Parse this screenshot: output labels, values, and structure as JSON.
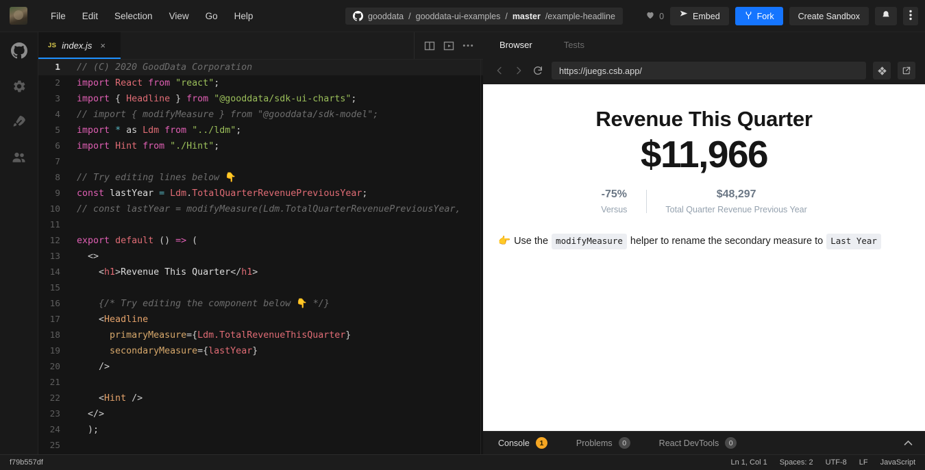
{
  "topbar": {
    "menu": [
      "File",
      "Edit",
      "Selection",
      "View",
      "Go",
      "Help"
    ],
    "repo": {
      "owner": "gooddata",
      "sep1": "/",
      "name": "gooddata-ui-examples",
      "sep2": "/",
      "branch": "master",
      "path": "/example-headline",
      "icon": "github-icon"
    },
    "likes_count": "0",
    "like_icon": "heart-icon",
    "embed_label": "Embed",
    "embed_icon": "share-icon",
    "fork_label": "Fork",
    "fork_icon": "fork-icon",
    "create_sandbox_label": "Create Sandbox",
    "notification_icon": "bell-icon",
    "more_icon": "kebab-menu-icon",
    "accent_color": "#1575ff"
  },
  "activitybar": {
    "items": [
      {
        "icon": "github-icon",
        "name": "github"
      },
      {
        "icon": "gear-icon",
        "name": "settings"
      },
      {
        "icon": "rocket-icon",
        "name": "deploy"
      },
      {
        "icon": "people-icon",
        "name": "collaborators"
      }
    ]
  },
  "editor": {
    "tab": {
      "badge": "JS",
      "name": "index.js",
      "close": "×"
    },
    "actions": [
      {
        "icon": "split-editor-icon"
      },
      {
        "icon": "preview-panel-icon"
      },
      {
        "icon": "more-options-icon"
      }
    ],
    "active_line": 1,
    "lines": [
      {
        "n": 1,
        "tokens": [
          {
            "t": "comment",
            "s": "// (C) 2020 GoodData Corporation"
          }
        ]
      },
      {
        "n": 2,
        "tokens": [
          {
            "t": "kw",
            "s": "import"
          },
          {
            "t": "plain",
            "s": " "
          },
          {
            "t": "id",
            "s": "React"
          },
          {
            "t": "plain",
            "s": " "
          },
          {
            "t": "kw",
            "s": "from"
          },
          {
            "t": "plain",
            "s": " "
          },
          {
            "t": "str",
            "s": "\"react\""
          },
          {
            "t": "punct",
            "s": ";"
          }
        ]
      },
      {
        "n": 3,
        "tokens": [
          {
            "t": "kw",
            "s": "import"
          },
          {
            "t": "plain",
            "s": " { "
          },
          {
            "t": "id",
            "s": "Headline"
          },
          {
            "t": "plain",
            "s": " } "
          },
          {
            "t": "kw",
            "s": "from"
          },
          {
            "t": "plain",
            "s": " "
          },
          {
            "t": "str",
            "s": "\"@gooddata/sdk-ui-charts\""
          },
          {
            "t": "punct",
            "s": ";"
          }
        ]
      },
      {
        "n": 4,
        "tokens": [
          {
            "t": "comment",
            "s": "// import { modifyMeasure } from \"@gooddata/sdk-model\";"
          }
        ]
      },
      {
        "n": 5,
        "tokens": [
          {
            "t": "kw",
            "s": "import"
          },
          {
            "t": "plain",
            "s": " "
          },
          {
            "t": "op",
            "s": "*"
          },
          {
            "t": "plain",
            "s": " as "
          },
          {
            "t": "id",
            "s": "Ldm"
          },
          {
            "t": "plain",
            "s": " "
          },
          {
            "t": "kw",
            "s": "from"
          },
          {
            "t": "plain",
            "s": " "
          },
          {
            "t": "str",
            "s": "\"../ldm\""
          },
          {
            "t": "punct",
            "s": ";"
          }
        ]
      },
      {
        "n": 6,
        "tokens": [
          {
            "t": "kw",
            "s": "import"
          },
          {
            "t": "plain",
            "s": " "
          },
          {
            "t": "id",
            "s": "Hint"
          },
          {
            "t": "plain",
            "s": " "
          },
          {
            "t": "kw",
            "s": "from"
          },
          {
            "t": "plain",
            "s": " "
          },
          {
            "t": "str",
            "s": "\"./Hint\""
          },
          {
            "t": "punct",
            "s": ";"
          }
        ]
      },
      {
        "n": 7,
        "tokens": []
      },
      {
        "n": 8,
        "tokens": [
          {
            "t": "comment",
            "s": "// Try editing lines below "
          },
          {
            "t": "plain",
            "s": "👇"
          }
        ]
      },
      {
        "n": 9,
        "tokens": [
          {
            "t": "kw",
            "s": "const"
          },
          {
            "t": "plain",
            "s": " "
          },
          {
            "t": "white",
            "s": "lastYear"
          },
          {
            "t": "plain",
            "s": " "
          },
          {
            "t": "op",
            "s": "="
          },
          {
            "t": "plain",
            "s": " "
          },
          {
            "t": "id",
            "s": "Ldm"
          },
          {
            "t": "punct",
            "s": "."
          },
          {
            "t": "id",
            "s": "TotalQuarterRevenuePreviousYear"
          },
          {
            "t": "punct",
            "s": ";"
          }
        ]
      },
      {
        "n": 10,
        "tokens": [
          {
            "t": "comment",
            "s": "// const lastYear = modifyMeasure(Ldm.TotalQuarterRevenuePreviousYear,"
          }
        ]
      },
      {
        "n": 11,
        "tokens": []
      },
      {
        "n": 12,
        "tokens": [
          {
            "t": "kw",
            "s": "export"
          },
          {
            "t": "plain",
            "s": " "
          },
          {
            "t": "id",
            "s": "default"
          },
          {
            "t": "plain",
            "s": " "
          },
          {
            "t": "punct",
            "s": "()"
          },
          {
            "t": "plain",
            "s": " "
          },
          {
            "t": "kw",
            "s": "=>"
          },
          {
            "t": "plain",
            "s": " ("
          }
        ]
      },
      {
        "n": 13,
        "tokens": [
          {
            "t": "plain",
            "s": "  "
          },
          {
            "t": "punct",
            "s": "<>"
          }
        ]
      },
      {
        "n": 14,
        "tokens": [
          {
            "t": "plain",
            "s": "    "
          },
          {
            "t": "punct",
            "s": "<"
          },
          {
            "t": "id",
            "s": "h1"
          },
          {
            "t": "punct",
            "s": ">"
          },
          {
            "t": "white",
            "s": "Revenue This Quarter"
          },
          {
            "t": "punct",
            "s": "</"
          },
          {
            "t": "id",
            "s": "h1"
          },
          {
            "t": "punct",
            "s": ">"
          }
        ]
      },
      {
        "n": 15,
        "tokens": []
      },
      {
        "n": 16,
        "tokens": [
          {
            "t": "plain",
            "s": "    "
          },
          {
            "t": "comment",
            "s": "{/* Try editing the component below "
          },
          {
            "t": "plain",
            "s": "👇"
          },
          {
            "t": "comment",
            "s": " */}"
          }
        ]
      },
      {
        "n": 17,
        "tokens": [
          {
            "t": "plain",
            "s": "    "
          },
          {
            "t": "punct",
            "s": "<"
          },
          {
            "t": "tag",
            "s": "Headline"
          }
        ]
      },
      {
        "n": 18,
        "tokens": [
          {
            "t": "plain",
            "s": "      "
          },
          {
            "t": "attr",
            "s": "primaryMeasure"
          },
          {
            "t": "punct",
            "s": "={"
          },
          {
            "t": "id",
            "s": "Ldm.TotalRevenueThisQuarter"
          },
          {
            "t": "punct",
            "s": "}"
          }
        ]
      },
      {
        "n": 19,
        "tokens": [
          {
            "t": "plain",
            "s": "      "
          },
          {
            "t": "attr",
            "s": "secondaryMeasure"
          },
          {
            "t": "punct",
            "s": "={"
          },
          {
            "t": "id",
            "s": "lastYear"
          },
          {
            "t": "punct",
            "s": "}"
          }
        ]
      },
      {
        "n": 20,
        "tokens": [
          {
            "t": "plain",
            "s": "    "
          },
          {
            "t": "punct",
            "s": "/>"
          }
        ]
      },
      {
        "n": 21,
        "tokens": []
      },
      {
        "n": 22,
        "tokens": [
          {
            "t": "plain",
            "s": "    "
          },
          {
            "t": "punct",
            "s": "<"
          },
          {
            "t": "tag",
            "s": "Hint"
          },
          {
            "t": "punct",
            "s": " />"
          }
        ]
      },
      {
        "n": 23,
        "tokens": [
          {
            "t": "plain",
            "s": "  "
          },
          {
            "t": "punct",
            "s": "</>"
          }
        ]
      },
      {
        "n": 24,
        "tokens": [
          {
            "t": "plain",
            "s": "  );"
          }
        ]
      },
      {
        "n": 25,
        "tokens": []
      }
    ]
  },
  "preview": {
    "tabs": [
      {
        "label": "Browser",
        "active": true
      },
      {
        "label": "Tests",
        "active": false
      }
    ],
    "back_icon": "chevron-left-icon",
    "forward_icon": "chevron-right-icon",
    "reload_icon": "reload-icon",
    "url": "https://juegs.csb.app/",
    "action_icons": [
      {
        "icon": "codesandbox-logo-icon"
      },
      {
        "icon": "open-external-icon"
      }
    ],
    "headline": {
      "title": "Revenue This Quarter",
      "value": "$11,966",
      "secondaries": [
        {
          "value": "-75%",
          "label": "Versus"
        },
        {
          "value": "$48,297",
          "label": "Total Quarter Revenue Previous Year"
        }
      ]
    },
    "hint": {
      "emoji": "👉",
      "text_1": "Use the",
      "code_1": "modifyMeasure",
      "text_2": "helper to rename the secondary measure to",
      "code_2": "Last Year"
    },
    "console": {
      "items": [
        {
          "label": "Console",
          "count": "1",
          "warn": true,
          "active": true
        },
        {
          "label": "Problems",
          "count": "0",
          "warn": false,
          "active": false
        },
        {
          "label": "React DevTools",
          "count": "0",
          "warn": false,
          "active": false
        }
      ],
      "collapse_icon": "chevron-up-icon"
    }
  },
  "statusbar": {
    "commit": "f79b557df",
    "items": [
      "Ln 1, Col 1",
      "Spaces: 2",
      "UTF-8",
      "LF",
      "JavaScript"
    ]
  }
}
